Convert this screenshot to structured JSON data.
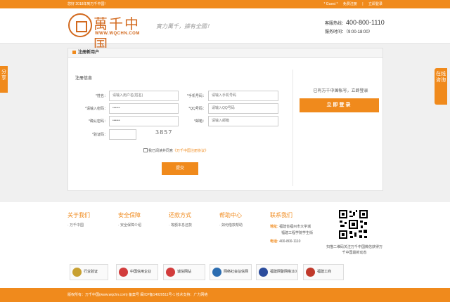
{
  "topbar": {
    "welcome": "您好 2018年到万千中国!",
    "guest": "* Guest *",
    "register": "免费注册",
    "sep": "|",
    "login": "立即登录"
  },
  "header": {
    "logo_title": "萬千中国",
    "logo_url": "WWW.WQCHN.COM",
    "slogan": "實力萬千，據有全國！",
    "hotline_label": "客服热线：",
    "hotline_number": "400-800-1110",
    "worktime": "服务时间：（9:00-18:00）"
  },
  "side": {
    "share": "分享",
    "consult": "在线咨询"
  },
  "panel": {
    "title": "注册新用户",
    "section": "注册信息",
    "fields": {
      "name_label": "*姓名：",
      "name_placeholder": "请输入用户名(姓名)",
      "phone_label": "*手机号码：",
      "phone_placeholder": "请输入手机号码",
      "pwd_label": "*请输入密码：",
      "pwd_value": "••••••",
      "qq_label": "*QQ号码：",
      "qq_placeholder": "请输入QQ号码",
      "confirm_label": "*确认密码：",
      "confirm_value": "••••••",
      "email_label": "*邮箱：",
      "email_placeholder": "请输入邮箱",
      "captcha_label": "*验证码：",
      "captcha_image": "3857"
    },
    "agree_text": "我已阅读并同意",
    "agree_link": "《万千中国注册协议》",
    "submit": "提交",
    "login_tip": "已有万千中国帐号，立即登录",
    "login_button": "立即登录"
  },
  "footer": {
    "cols": [
      {
        "title": "关于我们",
        "link": "· 万千中国"
      },
      {
        "title": "安全保障",
        "link": "· 安全保障介绍"
      },
      {
        "title": "还款方式",
        "link": "· 等额本息还款"
      },
      {
        "title": "帮助中心",
        "link": "· 如何借款帮助"
      }
    ],
    "contact_title": "联系我们",
    "address_label": "地址:",
    "address_1": "福建省福州市大学城",
    "address_2": "福建工程学院学生街",
    "phone_label": "电话:",
    "phone": "400-800-1110",
    "qr_text": "扫描二维码关注万千中国微信获得万千中国最新动态",
    "badges": [
      {
        "label": "行业验证",
        "color": "#c8a030"
      },
      {
        "label": "中国信用企业",
        "color": "#d23c3c"
      },
      {
        "label": "诚信网站",
        "color": "#d23c3c"
      },
      {
        "label": "网络社会征信网",
        "color": "#2b6cb0"
      },
      {
        "label": "福建网警网络110",
        "color": "#2b4c9c"
      },
      {
        "label": "福建工商",
        "color": "#c0392b"
      }
    ],
    "copyright": "版权所有：万千中国(www.wqchn.com) 备案号 闽ICP备14020511号-1 技术支持：广力网络"
  }
}
